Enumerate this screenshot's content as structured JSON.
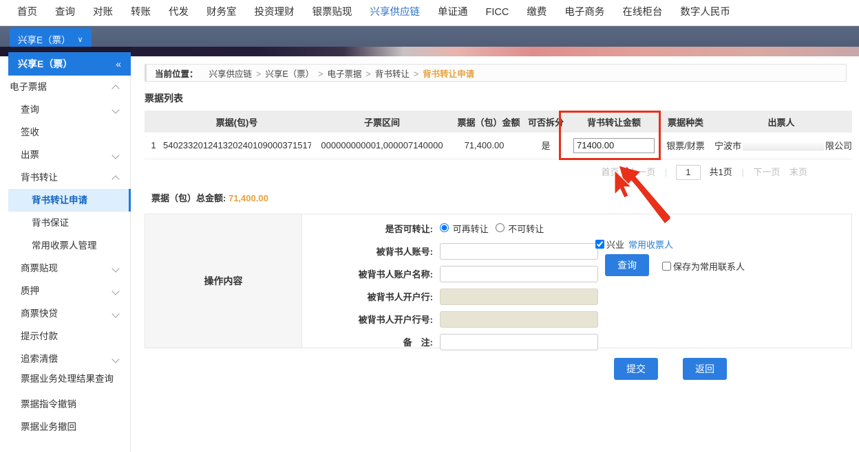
{
  "topnav": {
    "items": [
      {
        "label": "首页",
        "active": false
      },
      {
        "label": "查询",
        "active": false
      },
      {
        "label": "对账",
        "active": false
      },
      {
        "label": "转账",
        "active": false
      },
      {
        "label": "代发",
        "active": false
      },
      {
        "label": "财务室",
        "active": false
      },
      {
        "label": "投资理财",
        "active": false
      },
      {
        "label": "银票贴现",
        "active": false
      },
      {
        "label": "兴享供应链",
        "active": true
      },
      {
        "label": "单证通",
        "active": false
      },
      {
        "label": "FICC",
        "active": false
      },
      {
        "label": "缴费",
        "active": false
      },
      {
        "label": "电子商务",
        "active": false
      },
      {
        "label": "在线柜台",
        "active": false
      },
      {
        "label": "数字人民币",
        "active": false
      }
    ]
  },
  "subtab": {
    "label": "兴享E（票）",
    "chevron": "∨"
  },
  "sidebar": {
    "title": "兴享E（票）",
    "collapse_icon": "«",
    "items": [
      {
        "label": "电子票据",
        "level": 0,
        "arrow": "up",
        "active": false
      },
      {
        "label": "查询",
        "level": 1,
        "arrow": "down",
        "active": false
      },
      {
        "label": "签收",
        "level": 1,
        "arrow": "none",
        "active": false
      },
      {
        "label": "出票",
        "level": 1,
        "arrow": "down",
        "active": false
      },
      {
        "label": "背书转让",
        "level": 1,
        "arrow": "up",
        "active": false
      },
      {
        "label": "背书转让申请",
        "level": 2,
        "arrow": "none",
        "active": true
      },
      {
        "label": "背书保证",
        "level": 2,
        "arrow": "none",
        "active": false
      },
      {
        "label": "常用收票人管理",
        "level": 2,
        "arrow": "none",
        "active": false
      },
      {
        "label": "商票贴现",
        "level": 1,
        "arrow": "down",
        "active": false
      },
      {
        "label": "质押",
        "level": 1,
        "arrow": "down",
        "active": false
      },
      {
        "label": "商票快贷",
        "level": 1,
        "arrow": "down",
        "active": false
      },
      {
        "label": "提示付款",
        "level": 1,
        "arrow": "none",
        "active": false
      },
      {
        "label": "追索清偿",
        "level": 1,
        "arrow": "down",
        "active": false
      },
      {
        "label": "票据业务处理结果查询",
        "level": 1,
        "arrow": "none",
        "active": false
      },
      {
        "label": "票据指令撤销",
        "level": 1,
        "arrow": "none",
        "active": false
      },
      {
        "label": "票据业务撤回",
        "level": 1,
        "arrow": "none",
        "active": false
      }
    ]
  },
  "breadcrumb": {
    "title": "当前位置：",
    "path": [
      "兴享供应链",
      "兴享E（票）",
      "电子票据",
      "背书转让"
    ],
    "current": "背书转让申请",
    "separator": ">"
  },
  "section": {
    "title": "票据列表"
  },
  "table": {
    "headers": {
      "index": "",
      "bill_no": "票据(包)号",
      "sub_range": "子票区间",
      "amount": "票据（包）金额",
      "splittable": "可否拆分",
      "transfer_amount": "背书转让金额",
      "bill_kind": "票据种类",
      "drawer": "出票人"
    },
    "rows": [
      {
        "index": "1",
        "bill_no": "540233201241320240109000371517",
        "sub_range": "000000000001,000007140000",
        "amount": "71,400.00",
        "splittable": "是",
        "transfer_amount": "71400.00",
        "bill_kind": "银票/财票",
        "drawer_prefix": "宁波市",
        "drawer_suffix": "限公司"
      }
    ]
  },
  "pager": {
    "first": "首页",
    "prev": "上一页",
    "page_value": "1",
    "total": "共1页",
    "next": "下一页",
    "last": "末页"
  },
  "total_line": {
    "label": "票据（包）总金额:",
    "amount": "71,400.00"
  },
  "operation": {
    "panel_title": "操作内容",
    "transferable": {
      "label": "是否可转让:",
      "options": [
        {
          "label": "可再转让",
          "checked": true
        },
        {
          "label": "不可转让",
          "checked": false
        }
      ]
    },
    "endorsee_account": {
      "label": "被背书人账号:",
      "value": "",
      "bank_checkbox_label": "兴业",
      "bank_checkbox_checked": true,
      "common_payee_link": "常用收票人"
    },
    "endorsee_name": {
      "label": "被背书人账户名称:",
      "value": "",
      "save_checkbox_label": "保存为常用联系人",
      "save_checkbox_checked": false
    },
    "endorsee_bank": {
      "label": "被背书人开户行:",
      "value": ""
    },
    "endorsee_bank_no": {
      "label": "被背书人开户行号:",
      "value": ""
    },
    "remark": {
      "label": "备　注:",
      "value": ""
    },
    "query_button": "查询"
  },
  "footer_buttons": {
    "submit": "提交",
    "back": "返回"
  },
  "colors": {
    "accent_blue": "#2b7de0",
    "nav_active": "#2a6fc9",
    "highlight_red": "#e8301a",
    "amount_orange": "#e8a33d"
  }
}
